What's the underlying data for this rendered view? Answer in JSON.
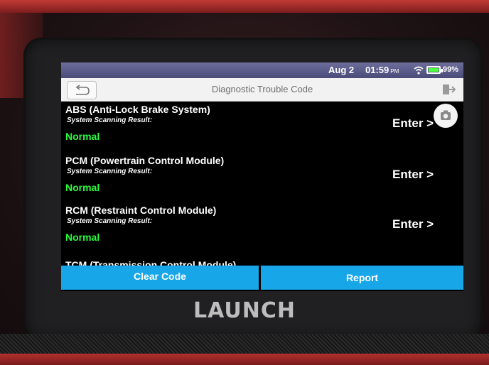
{
  "status_bar": {
    "date": "Aug 2",
    "time": "01:59",
    "ampm": "PM",
    "battery": "99%",
    "battery_color": "#4cff3c"
  },
  "header": {
    "title": "Diagnostic Trouble Code",
    "back_icon": "back-arrow-icon",
    "exit_icon": "exit-icon"
  },
  "modules": [
    {
      "name": "ABS (Anti-Lock Brake System)",
      "scan_label": "System Scanning Result:",
      "status": "Normal",
      "action": "Enter >"
    },
    {
      "name": "PCM (Powertrain Control Module)",
      "scan_label": "System Scanning Result:",
      "status": "Normal",
      "action": "Enter >"
    },
    {
      "name": "RCM (Restraint Control Module)",
      "scan_label": "System Scanning Result:",
      "status": "Normal",
      "action": "Enter >"
    },
    {
      "name": "TCM (Transmission Control Module)"
    }
  ],
  "actions": {
    "clear_code": "Clear Code",
    "report": "Report",
    "accent": "#17a7e8"
  },
  "brand": "LAUNCH",
  "status_color": "#27ff3a"
}
